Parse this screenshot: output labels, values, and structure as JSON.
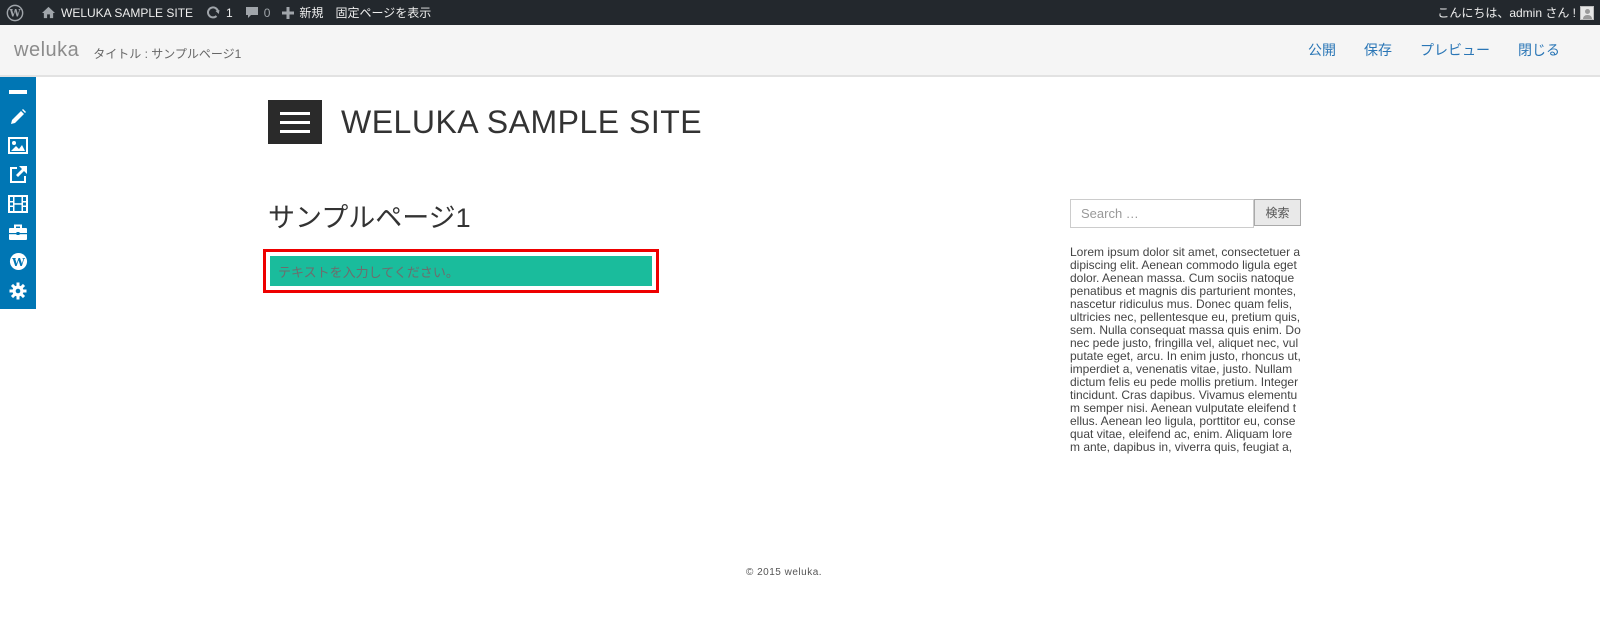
{
  "admin_bar": {
    "site_name": "WELUKA SAMPLE SITE",
    "updates_count": "1",
    "comments_count": "0",
    "new_label": "新規",
    "view_page_label": "固定ページを表示",
    "greeting": "こんにちは、admin さん !"
  },
  "editor_bar": {
    "brand": "weluka",
    "title_meta": "タイトル : サンプルページ1",
    "actions": [
      "公開",
      "保存",
      "プレビュー",
      "閉じる"
    ]
  },
  "tool_rail": {
    "icons": [
      "minus-icon",
      "pencil-icon",
      "image-icon",
      "external-link-icon",
      "film-icon",
      "briefcase-icon",
      "wordpress-icon",
      "gear-icon"
    ]
  },
  "site": {
    "name": "WELUKA SAMPLE SITE"
  },
  "content": {
    "page_title": "サンプルページ1",
    "text_placeholder": "テキストを入力してください。"
  },
  "sidebar": {
    "search_placeholder": "Search …",
    "search_button": "検索",
    "widget_text": "Lorem ipsum dolor sit amet, consectetuer adipiscing elit. Aenean commodo ligula eget dolor. Aenean massa. Cum sociis natoque penatibus et magnis dis parturient montes, nascetur ridiculus mus. Donec quam felis, ultricies nec, pellentesque eu, pretium quis, sem. Nulla consequat massa quis enim. Donec pede justo, fringilla vel, aliquet nec, vulputate eget, arcu. In enim justo, rhoncus ut, imperdiet a, venenatis vitae, justo. Nullam dictum felis eu pede mollis pretium. Integer tincidunt. Cras dapibus. Vivamus elementum semper nisi. Aenean vulputate eleifend tellus. Aenean leo ligula, porttitor eu, consequat vitae, eleifend ac, enim. Aliquam lorem ante, dapibus in, viverra quis, feugiat a,"
  },
  "footer": {
    "copyright": "© 2015 weluka."
  },
  "colors": {
    "admin_bar_bg": "#23282d",
    "rail_bg": "#0076b4",
    "link": "#2a76b6",
    "text_block_bg": "#1abc9c",
    "highlight_border": "#ee0000"
  }
}
